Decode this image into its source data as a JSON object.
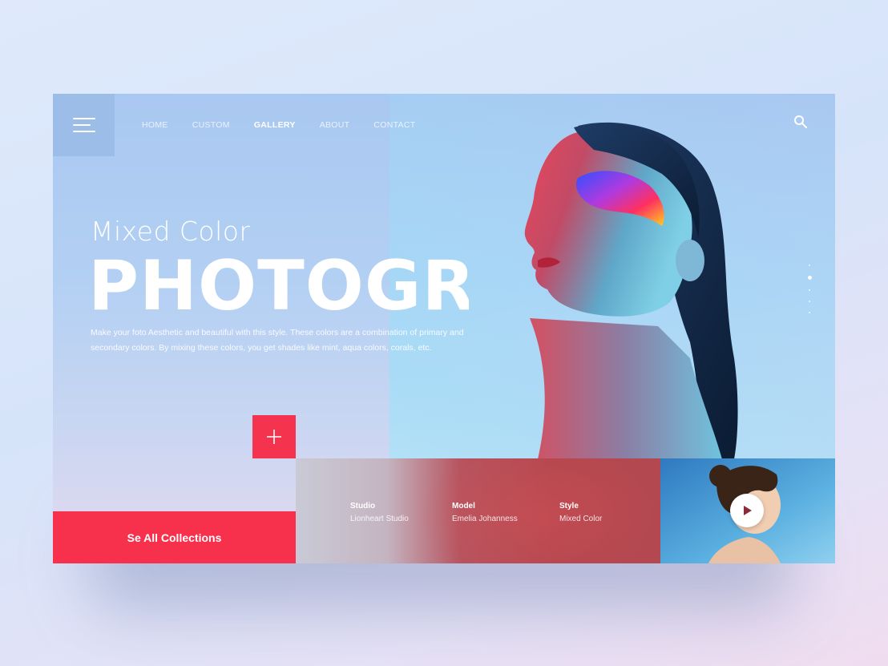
{
  "nav": {
    "menu_icon": "hamburger-icon",
    "items": [
      {
        "label": "HOME"
      },
      {
        "label": "CUSTOM"
      },
      {
        "label": "GALLERY",
        "active": true
      },
      {
        "label": "ABOUT"
      },
      {
        "label": "CONTACT"
      }
    ],
    "search_icon": "search-icon"
  },
  "hero": {
    "subtitle": "Mixed Color",
    "title": "PHOTOGRA",
    "description": "Make your foto Aesthetic and beautiful with this style. These colors are a combination of primary and secondary colors. By mixing these colors, you get shades like mint, aqua colors, corals, etc."
  },
  "actions": {
    "plus_icon": "plus-icon",
    "collections_label": "Se All Collections",
    "play_icon": "play-icon"
  },
  "details": [
    {
      "label": "Studio",
      "value": "Lionheart Studio"
    },
    {
      "label": "Model",
      "value": "Emelia Johanness"
    },
    {
      "label": "Style",
      "value": "Mixed Color"
    }
  ],
  "pagination": {
    "count": 5,
    "active_index": 1
  },
  "colors": {
    "accent": "#f7304c",
    "background": "#a9c8f1",
    "menu_box": "#9dbde9"
  }
}
